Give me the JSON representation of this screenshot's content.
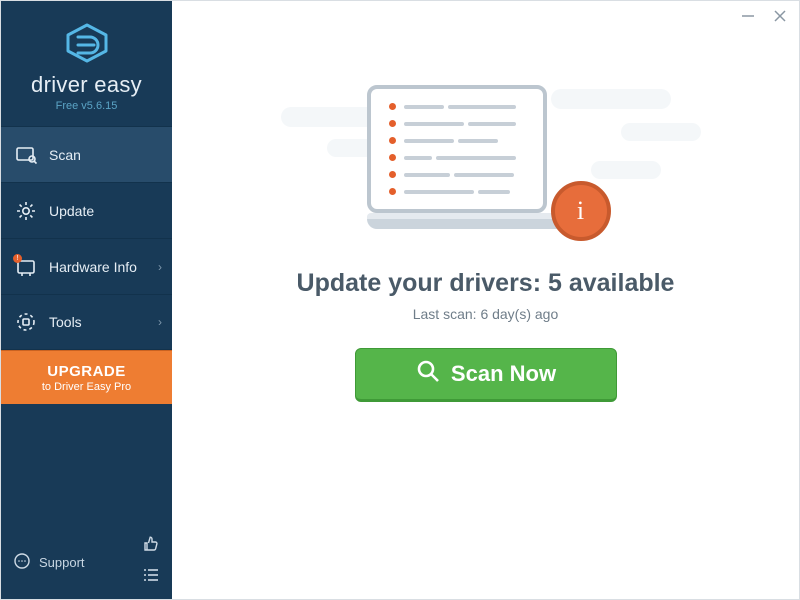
{
  "brand": {
    "name_a": "driver",
    "name_b": "easy",
    "version": "Free v5.6.15"
  },
  "colors": {
    "sidebar": "#183a57",
    "accent_orange": "#ee7d32",
    "accent_green": "#55b54a",
    "info_badge": "#e76d3b"
  },
  "sidebar": {
    "items": [
      {
        "label": "Scan",
        "icon": "scan-icon",
        "has_chevron": false,
        "active": true,
        "badge": false
      },
      {
        "label": "Update",
        "icon": "gear-icon",
        "has_chevron": false,
        "active": false,
        "badge": false
      },
      {
        "label": "Hardware Info",
        "icon": "hardware-icon",
        "has_chevron": true,
        "active": false,
        "badge": true
      },
      {
        "label": "Tools",
        "icon": "tools-icon",
        "has_chevron": true,
        "active": false,
        "badge": false
      }
    ],
    "upgrade": {
      "line1": "UPGRADE",
      "line2": "to Driver Easy Pro"
    },
    "support": "Support"
  },
  "main": {
    "headline_prefix": "Update your drivers: ",
    "available_count": 5,
    "headline_suffix": " available",
    "subline": "Last scan: 6 day(s) ago",
    "scan_button": "Scan Now",
    "info_badge_glyph": "i"
  }
}
